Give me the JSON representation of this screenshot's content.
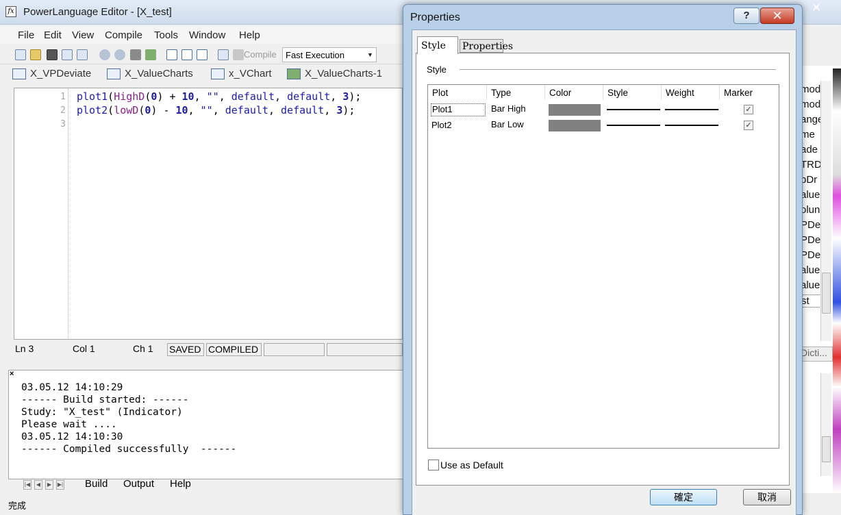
{
  "editor": {
    "title": "PowerLanguage Editor - [X_test]",
    "app_icon_glyph": "fx",
    "menu": [
      "File",
      "Edit",
      "View",
      "Compile",
      "Tools",
      "Window",
      "Help"
    ],
    "toolbar": {
      "compile_label": "Compile",
      "execution_mode": "Fast Execution"
    },
    "tabs": [
      "X_VPDeviate",
      "X_ValueCharts",
      "x_VChart",
      "X_ValueCharts-1"
    ],
    "code": {
      "line_numbers": [
        "1",
        "2",
        "3"
      ],
      "lines": [
        {
          "fn": "plot1",
          "arg_fn": "HighD",
          "op": "+",
          "num": "10"
        },
        {
          "fn": "plot2",
          "arg_fn": "lowD",
          "op": "-",
          "num": "10"
        }
      ],
      "line1_text": "plot1(HighD(0) + 10, \"\", default, default, 3);",
      "line2_text": "plot2(lowD(0) - 10, \"\", default, default, 3);"
    },
    "status": {
      "ln": "Ln 3",
      "col": "Col 1",
      "ch": "Ch 1",
      "saved": "SAVED",
      "compiled": "COMPILED"
    },
    "output": {
      "lines": [
        "03.05.12 14:10:29",
        "------ Build started: ------",
        "Study: \"X_test\" (Indicator)",
        "Please wait ....",
        "03.05.12 14:10:30",
        "------ Compiled successfully  ------"
      ],
      "tabs": [
        "Build",
        "Output",
        "Help"
      ],
      "close_glyph": "×"
    },
    "bottom_status": "完成",
    "right_pane": {
      "items": [
        "mod",
        "mod",
        "ange",
        "me",
        "ade",
        "TRD",
        "pDr",
        "alue",
        "olun",
        "PDe",
        "PDe",
        "PDe",
        "alue",
        "alue",
        "st"
      ],
      "tab_label": "Dicti..."
    },
    "close_glyph": "✕"
  },
  "dialog": {
    "title": "Properties",
    "help_glyph": "?",
    "close_glyph": "✕",
    "tabs": [
      "Style",
      "Properties"
    ],
    "group_label": "Style",
    "columns": [
      "Plot",
      "Type",
      "Color",
      "Style",
      "Weight",
      "Marker"
    ],
    "rows": [
      {
        "plot": "Plot1",
        "type": "Bar High",
        "color": "#808080",
        "marker": true
      },
      {
        "plot": "Plot2",
        "type": "Bar Low",
        "color": "#808080",
        "marker": true
      }
    ],
    "use_as_default": "Use as Default",
    "ok": "確定",
    "cancel": "取消"
  }
}
